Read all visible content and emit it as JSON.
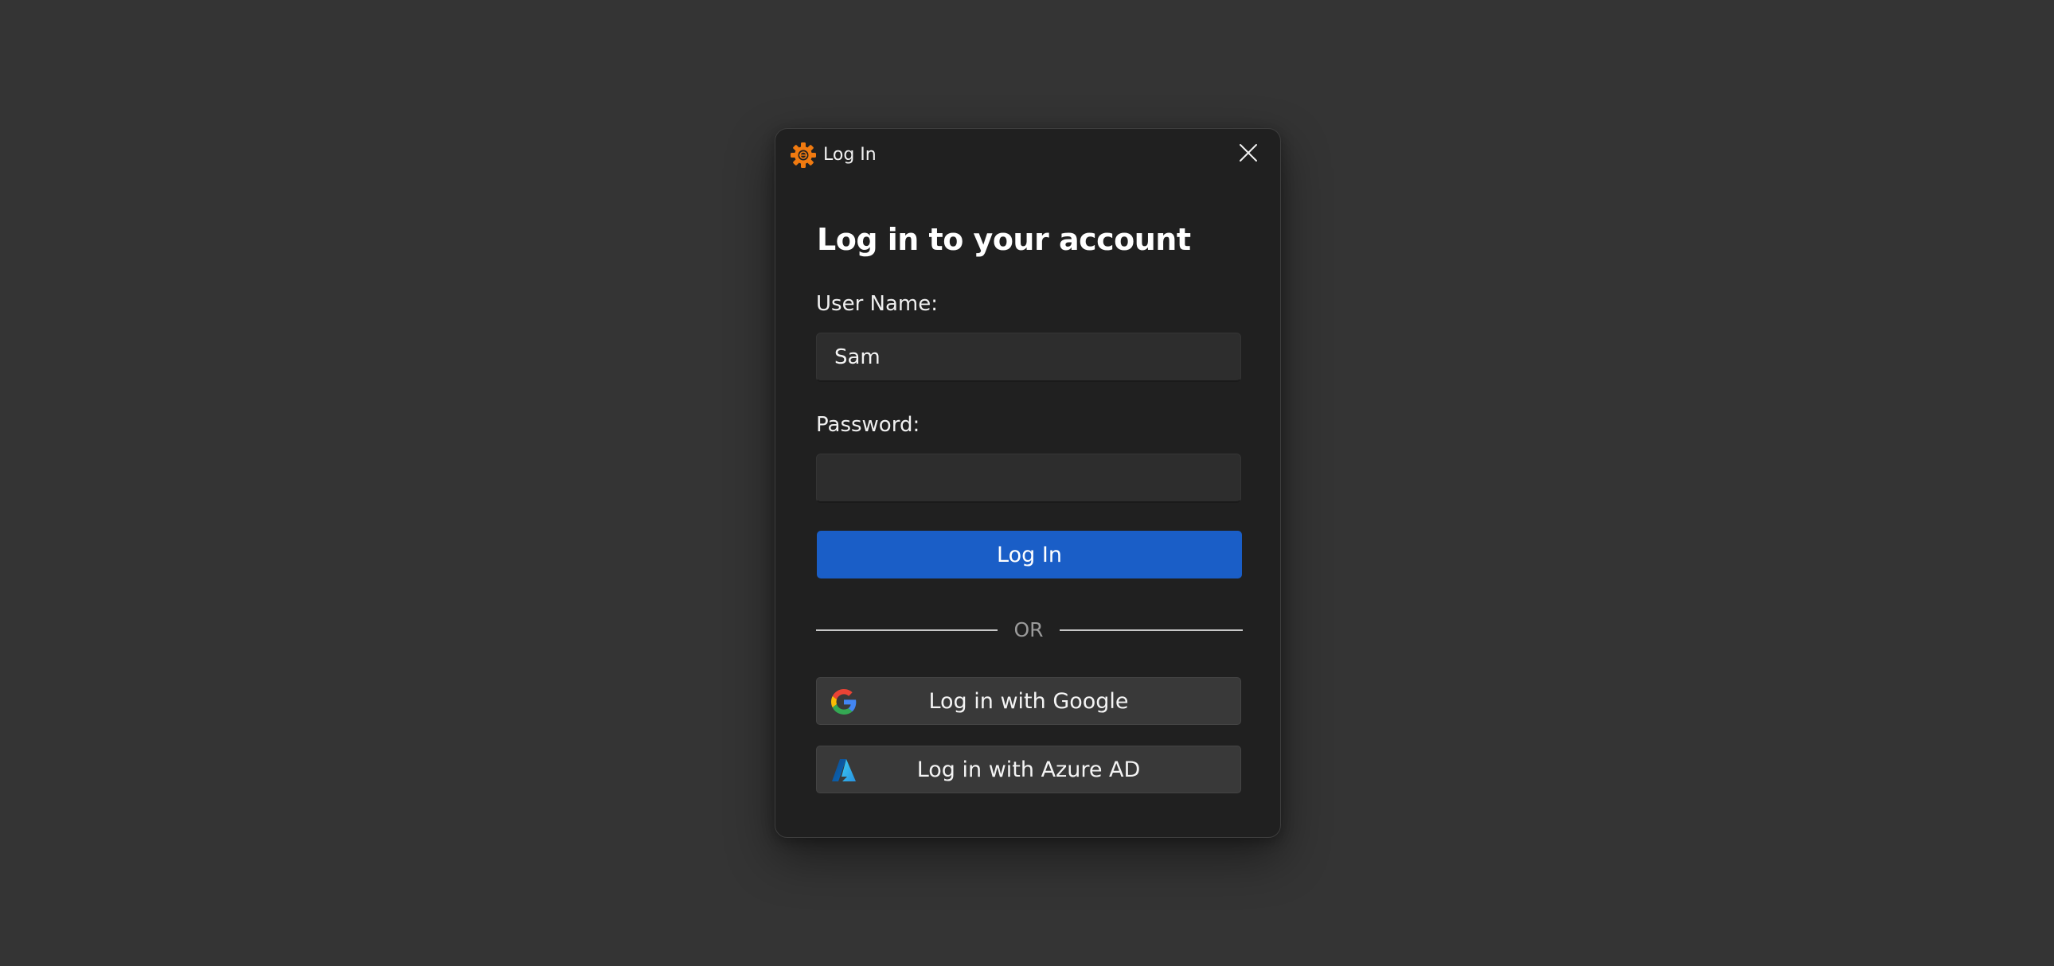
{
  "window": {
    "title": "Log In",
    "app_icon": "gear-icon",
    "close_icon": "close-icon"
  },
  "form": {
    "heading": "Log in to your account",
    "username_label": "User Name:",
    "username_value": "Sam",
    "password_label": "Password:",
    "password_value": "",
    "login_button": "Log In",
    "divider_text": "OR"
  },
  "sso": {
    "google_label": "Log in with Google",
    "google_icon": "google-logo-icon",
    "azure_label": "Log in with Azure AD",
    "azure_icon": "azure-logo-icon"
  },
  "colors": {
    "accent": "#1a5ec7",
    "app_icon": "#f07a10",
    "background": "#343434",
    "dialog": "#202020"
  }
}
